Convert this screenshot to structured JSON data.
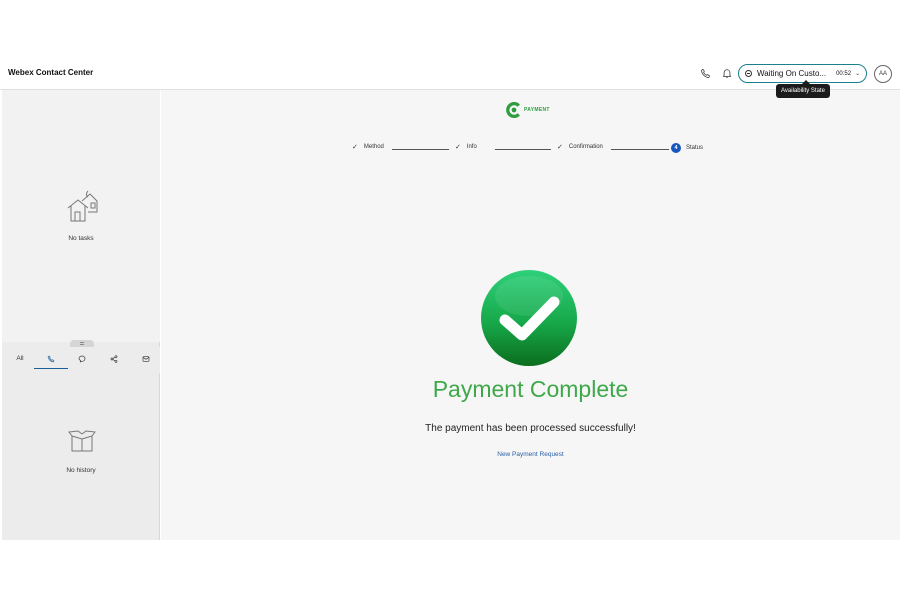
{
  "header": {
    "app_title": "Webex Contact Center",
    "state_label": "Waiting On Custo...",
    "state_timer": "00:52",
    "tooltip": "Availability State",
    "avatar_initials": "AA"
  },
  "sidebar": {
    "tasks_empty": "No tasks",
    "history_tabs": [
      {
        "label": "All",
        "icon": "all-label"
      },
      {
        "label": "",
        "icon": "phone-icon"
      },
      {
        "label": "",
        "icon": "chat-icon"
      },
      {
        "label": "",
        "icon": "social-icon"
      },
      {
        "label": "",
        "icon": "email-icon"
      }
    ],
    "active_tab": "phone-icon",
    "history_empty": "No history"
  },
  "main": {
    "logo_text": "PAYMENT",
    "steps": [
      {
        "label": "Method",
        "status": "done"
      },
      {
        "label": "Info",
        "status": "done"
      },
      {
        "label": "Confirmation",
        "status": "done"
      },
      {
        "label": "Status",
        "status": "current",
        "number": "4"
      }
    ],
    "title": "Payment Complete",
    "subtitle": "The payment has been processed successfully!",
    "new_request_link": "New Payment Request"
  },
  "colors": {
    "accent": "#1a7f8e",
    "success": "#3fa84a",
    "step_active": "#1757c2",
    "link": "#2a5fa8"
  }
}
